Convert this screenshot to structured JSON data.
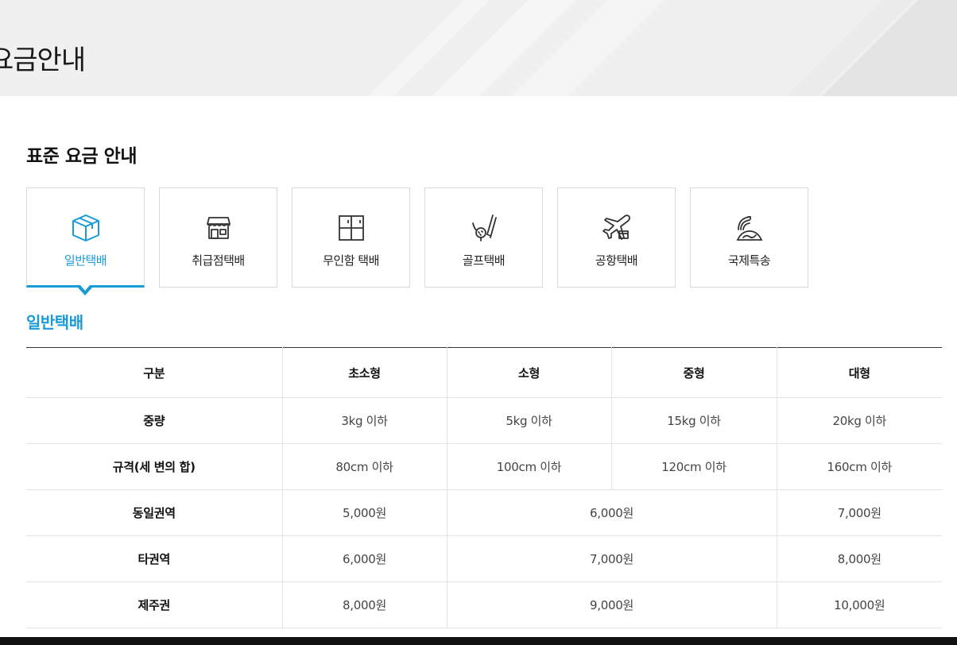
{
  "header": {
    "title": "요금안내"
  },
  "section": {
    "title": "표준 요금 안내"
  },
  "tabs": [
    {
      "label": "일반택배",
      "icon": "box-icon",
      "active": true
    },
    {
      "label": "취급점택배",
      "icon": "store-icon",
      "active": false
    },
    {
      "label": "무인함 택배",
      "icon": "locker-icon",
      "active": false
    },
    {
      "label": "골프택배",
      "icon": "golf-icon",
      "active": false
    },
    {
      "label": "공항택배",
      "icon": "airplane-icon",
      "active": false
    },
    {
      "label": "국제특송",
      "icon": "globe-icon",
      "active": false
    }
  ],
  "subsection": {
    "title": "일반택배"
  },
  "table": {
    "headers": [
      "구분",
      "초소형",
      "소형",
      "중형",
      "대형"
    ],
    "rows": {
      "weight": {
        "label": "중량",
        "cells": [
          "3kg 이하",
          "5kg 이하",
          "15kg 이하",
          "20kg 이하"
        ]
      },
      "size": {
        "label": "규격(세 변의 합)",
        "cells": [
          "80cm 이하",
          "100cm 이하",
          "120cm 이하",
          "160cm 이하"
        ]
      },
      "same_region": {
        "label": "동일권역",
        "cells": [
          "5,000원",
          "6,000원",
          "7,000원"
        ]
      },
      "other_region": {
        "label": "타권역",
        "cells": [
          "6,000원",
          "7,000원",
          "8,000원"
        ]
      },
      "jeju": {
        "label": "제주권",
        "cells": [
          "8,000원",
          "9,000원",
          "10,000원"
        ]
      }
    }
  },
  "colors": {
    "accent": "#1a9ad7",
    "text": "#222222",
    "border": "#d9d9d9"
  }
}
